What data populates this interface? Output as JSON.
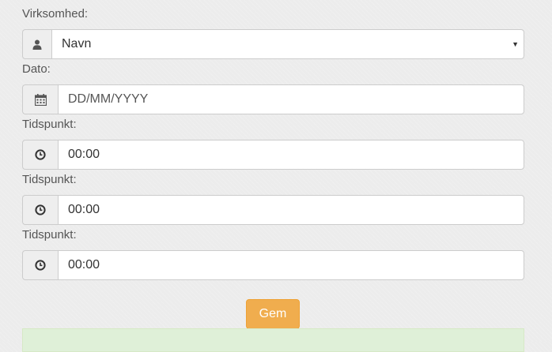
{
  "form": {
    "company": {
      "label": "Virksomhed:",
      "selected": "Navn",
      "icon": "user-icon"
    },
    "date": {
      "label": "Dato:",
      "placeholder": "DD/MM/YYYY",
      "icon": "calendar-icon"
    },
    "times": [
      {
        "label": "Tidspunkt:",
        "value": "00:00",
        "icon": "clock-icon"
      },
      {
        "label": "Tidspunkt:",
        "value": "00:00",
        "icon": "clock-icon"
      },
      {
        "label": "Tidspunkt:",
        "value": "00:00",
        "icon": "clock-icon"
      }
    ],
    "submit_label": "Gem"
  },
  "colors": {
    "submit": "#f0ad4e",
    "success_alert": "#dff0d8"
  }
}
